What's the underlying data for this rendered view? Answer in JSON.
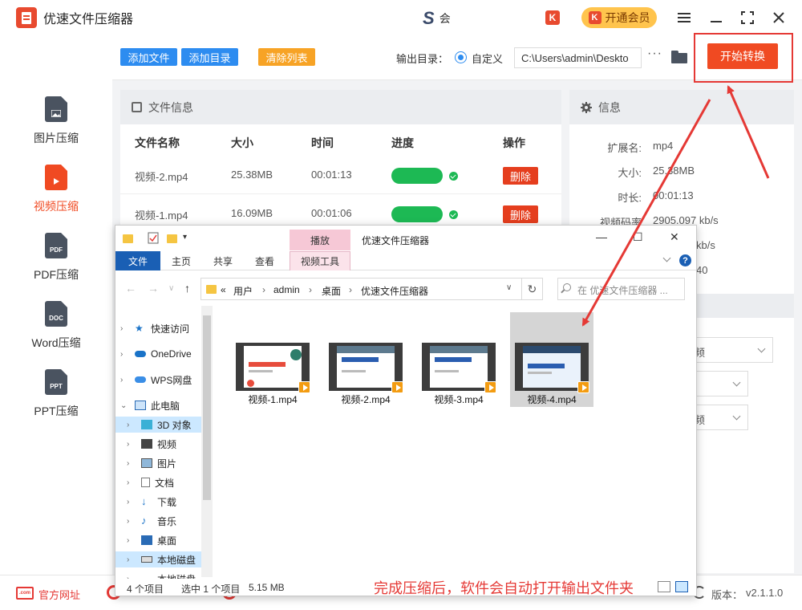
{
  "app": {
    "title": "优速文件压缩器",
    "center_brand": "S",
    "center_text": "会",
    "k_badge": "K",
    "vip_label": "开通会员"
  },
  "nav": [
    {
      "label": "图片压缩",
      "icon": "image-file-icon",
      "active": false
    },
    {
      "label": "视频压缩",
      "icon": "video-file-icon",
      "active": true
    },
    {
      "label": "PDF压缩",
      "icon_text": "PDF",
      "active": false
    },
    {
      "label": "Word压缩",
      "icon_text": "DOC",
      "active": false
    },
    {
      "label": "PPT压缩",
      "icon_text": "PPT",
      "active": false
    }
  ],
  "toolbar": {
    "add_file": "添加文件",
    "add_dir": "添加目录",
    "clear_list": "清除列表",
    "output_label": "输出目录：",
    "radio_label": "自定义",
    "output_path": "C:\\Users\\admin\\Deskto",
    "more": "···",
    "start": "开始转换"
  },
  "file_panel": {
    "title": "文件信息",
    "columns": [
      "文件名称",
      "大小",
      "时间",
      "进度",
      "操作"
    ],
    "rows": [
      {
        "name": "视频-2.mp4",
        "size": "25.38MB",
        "time": "00:01:13",
        "progress": 1.0,
        "action": "删除"
      },
      {
        "name": "视频-1.mp4",
        "size": "16.09MB",
        "time": "00:01:06",
        "progress": 1.0,
        "action": "删除"
      }
    ]
  },
  "info_panel": {
    "title": "信息",
    "ext_label": "扩展名:",
    "ext": "mp4",
    "size_label": "大小:",
    "size": "25.38MB",
    "dur_label": "时长:",
    "dur": "00:01:13",
    "bitrate_label": "视频码率",
    "bitrate": "2905.097 kb/s",
    "partial_1": "kb/s",
    "partial_2": "40"
  },
  "settings": {
    "select_1": "频",
    "select_3": "频"
  },
  "footer": {
    "site_icon": ".com",
    "site": "官方网址",
    "version_label": "版本：",
    "version": "v2.1.1.0"
  },
  "explorer": {
    "context_tab": "播放",
    "title": "优速文件压缩器",
    "ribbon": [
      "文件",
      "主页",
      "共享",
      "查看",
      "视频工具"
    ],
    "help": "?",
    "address": {
      "lead": "«",
      "parts": [
        "用户",
        "admin",
        "桌面",
        "优速文件压缩器"
      ]
    },
    "search_placeholder": "在 优速文件压缩器 ...",
    "tree": {
      "quick": "快速访问",
      "onedrive": "OneDrive",
      "wps": "WPS网盘",
      "pc": "此电脑",
      "obj3d": "3D 对象",
      "video": "视频",
      "pictures": "图片",
      "docs": "文档",
      "download": "下载",
      "music": "音乐",
      "desktop": "桌面",
      "localdisk": "本地磁盘",
      "localdisk2": "本地磁盘"
    },
    "files": [
      {
        "name": "视频-1.mp4",
        "slide_title": "如何批量给图片加边框?",
        "selected": false
      },
      {
        "name": "视频-2.mp4",
        "slide_title": "如何批量在文件名前加序号?",
        "selected": false
      },
      {
        "name": "视频-3.mp4",
        "slide_title": "如何批量给文件名称添加序号",
        "selected": false
      },
      {
        "name": "视频-4.mp4",
        "slide_title": "图片放大不失真的方法",
        "selected": true
      }
    ],
    "annotation": "完成压缩后，软件会自动打开输出文件夹",
    "status_count": "4 个项目",
    "status_selected": "选中 1 个项目",
    "status_size": "5.15 MB"
  },
  "colors": {
    "accent": "#f04a22",
    "blue_button": "#2d8cf0",
    "orange_button": "#f7a325",
    "progress": "#1db954",
    "annotation": "#e53935"
  }
}
